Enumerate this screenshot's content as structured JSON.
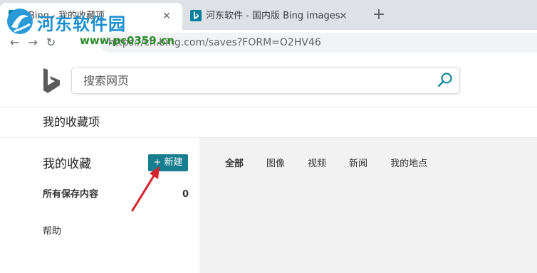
{
  "browser": {
    "tabs": [
      {
        "title": "Bing - 我的收藏项",
        "active": true
      },
      {
        "title": "河东软件 - 国内版 Bing images",
        "active": false
      }
    ],
    "new_tab_glyph": "+",
    "close_glyph": "✕",
    "url": "https://cn.bing.com/saves?FORM=O2HV46"
  },
  "watermark": {
    "title": "河东软件园",
    "url": "www.pc0359.cn"
  },
  "search": {
    "placeholder": "搜索网页",
    "icon": "search-icon"
  },
  "subheader": {
    "title": "我的收藏项"
  },
  "sidebar": {
    "title": "我的收藏",
    "new_button": "+ 新建",
    "all_saves_label": "所有保存内容",
    "all_saves_count": "0",
    "help": "帮助"
  },
  "filters": [
    {
      "label": "全部",
      "active": true
    },
    {
      "label": "图像",
      "active": false
    },
    {
      "label": "视频",
      "active": false
    },
    {
      "label": "新闻",
      "active": false
    },
    {
      "label": "我的地点",
      "active": false
    }
  ],
  "colors": {
    "accent": "#177d8f",
    "bing_teal": "#00809d",
    "annotation": "#d8232a"
  }
}
